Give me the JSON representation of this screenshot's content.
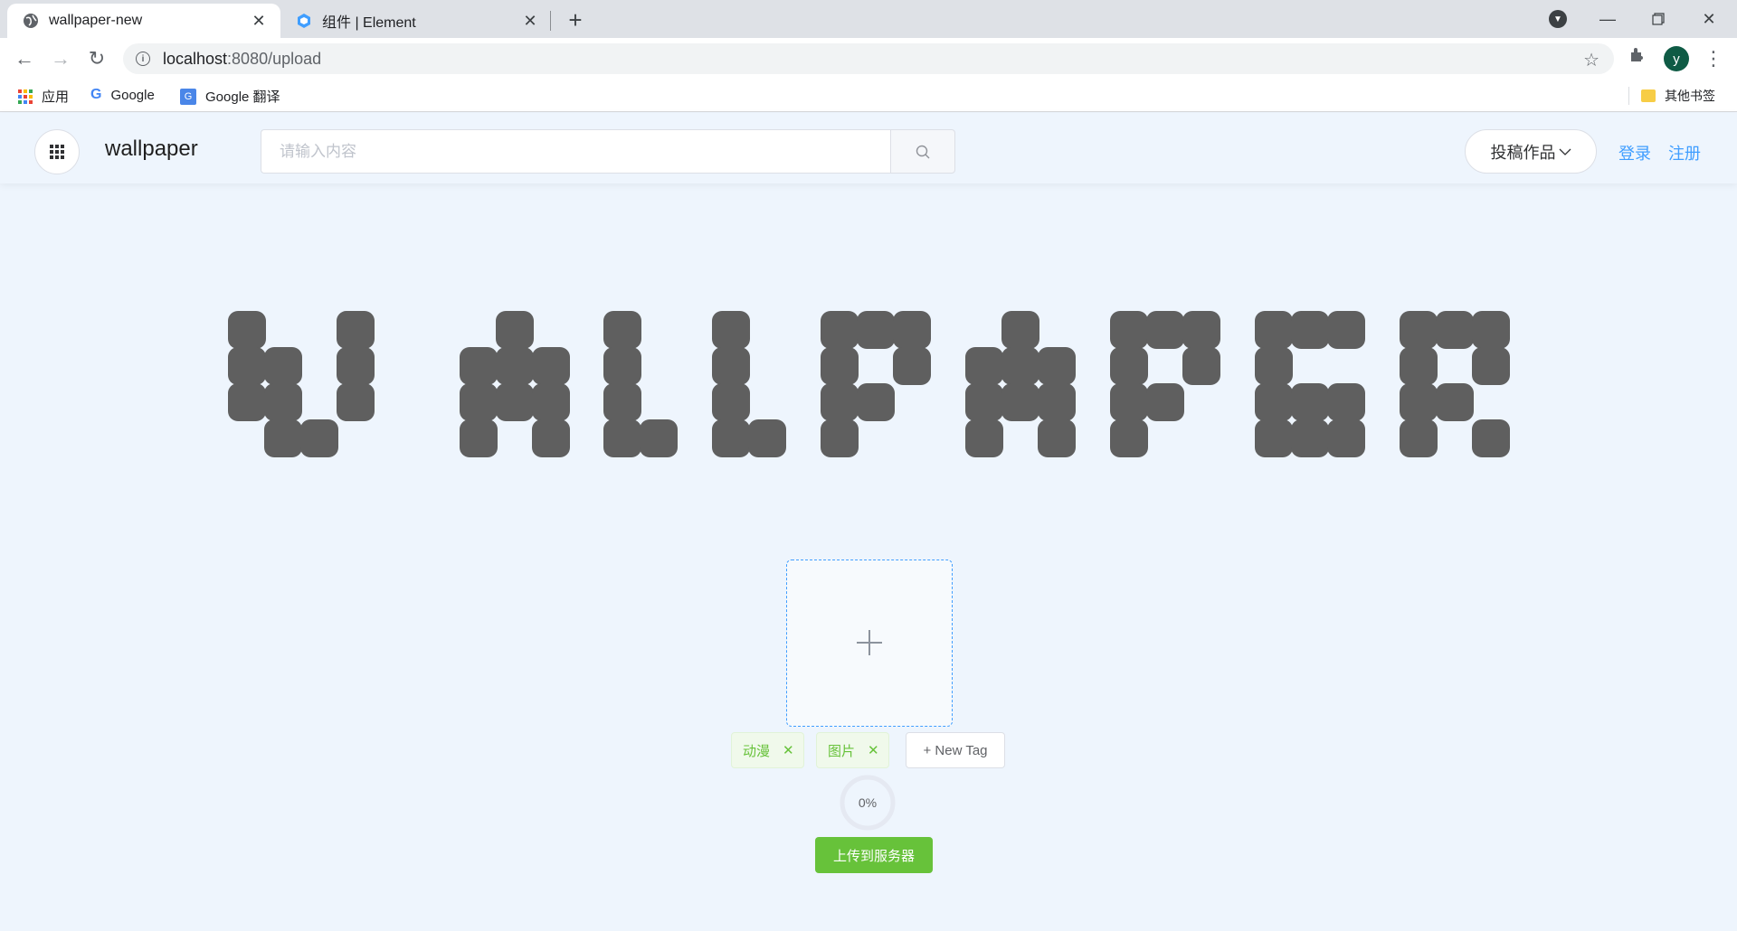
{
  "browser": {
    "tabs": [
      {
        "title": "wallpaper-new",
        "active": true
      },
      {
        "title": "组件 | Element",
        "active": false
      }
    ],
    "url_host": "localhost",
    "url_path": ":8080/upload",
    "avatar_letter": "y",
    "bookmarks": [
      {
        "label": "应用",
        "icon": "apps-grid-icon"
      },
      {
        "label": "Google",
        "icon": "google-icon"
      },
      {
        "label": "Google 翻译",
        "icon": "google-translate-icon"
      }
    ],
    "other_bookmarks": "其他书签"
  },
  "header": {
    "brand": "wallpaper",
    "search_placeholder": "请输入内容",
    "submit_label": "投稿作品",
    "login": "登录",
    "register": "注册"
  },
  "logo_text": "WALLPAPER",
  "upload": {
    "tags": [
      "动漫",
      "图片"
    ],
    "new_tag": "+ New Tag",
    "progress_text": "0%",
    "progress_value": 0,
    "upload_button": "上传到服务器"
  },
  "colors": {
    "accent": "#409eff",
    "success": "#67c23a",
    "page_bg": "#eef5fd",
    "logo_dot": "#5f5f5f"
  }
}
